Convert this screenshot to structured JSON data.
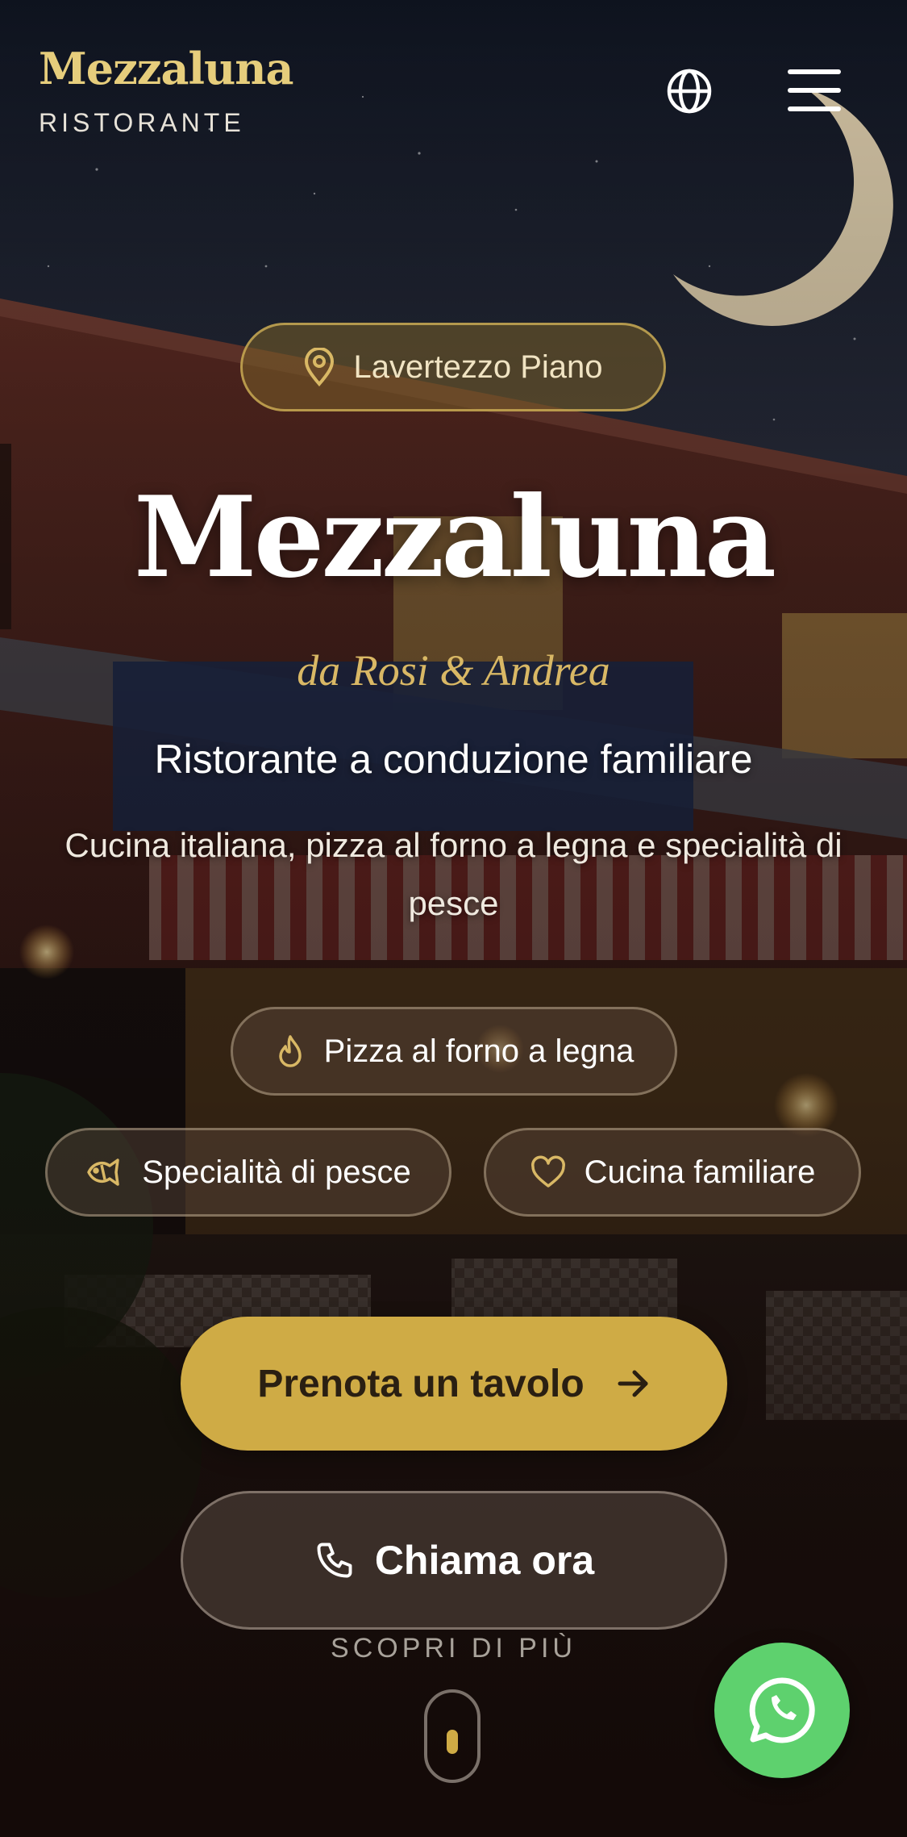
{
  "header": {
    "brand_name": "Mezzaluna",
    "brand_subtitle": "RISTORANTE",
    "language_icon": "globe-icon",
    "menu_icon": "hamburger-menu-icon"
  },
  "hero": {
    "location": "Lavertezzo Piano",
    "title": "Mezzaluna",
    "byline": "da Rosi & Andrea",
    "tagline": "Ristorante a conduzione familiare",
    "description": "Cucina italiana, pizza al forno a legna e specialità di pesce",
    "features": [
      {
        "label": "Pizza al forno a legna",
        "icon": "flame-icon"
      },
      {
        "label": "Specialità di pesce",
        "icon": "fish-icon"
      },
      {
        "label": "Cucina familiare",
        "icon": "heart-icon"
      }
    ],
    "primary_button": "Prenota un tavolo",
    "secondary_button": "Chiama ora",
    "scroll_hint": "SCOPRI DI PIÙ"
  },
  "colors": {
    "accent_gold": "#cfab45",
    "brand_gold": "#e6cd7c",
    "whatsapp_green": "#5ed16e"
  }
}
